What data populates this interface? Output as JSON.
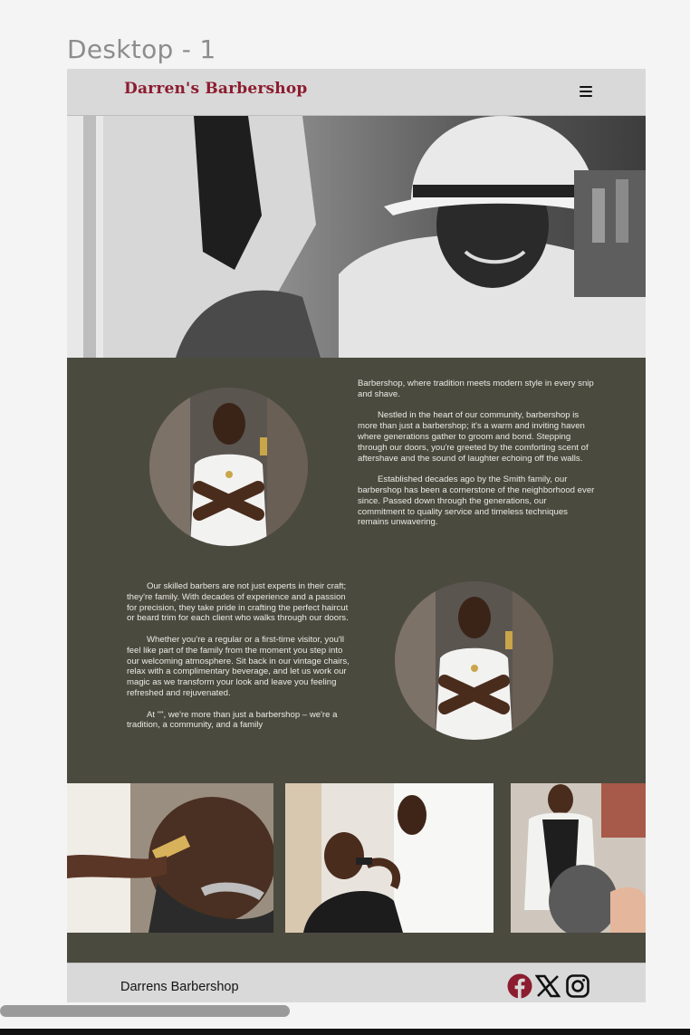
{
  "canvas": {
    "frame_title": "Desktop - 1"
  },
  "navbar": {
    "brand": "Darren's Barbershop",
    "menu_icon": "hamburger-menu-icon"
  },
  "about": {
    "paragraph_1": "Barbershop, where tradition meets modern style in every snip and shave.",
    "paragraph_2": "Nestled in the heart of our community, barbershop is more than just a barbershop; it's a warm and inviting haven where generations gather to groom and bond. Stepping through our doors, you're greeted by the comforting scent of aftershave and the sound of laughter echoing off the walls.",
    "paragraph_3": "Established decades ago by the Smith family, our barbershop has been a cornerstone of the neighborhood ever since. Passed down through the generations, our commitment to quality service and timeless techniques remains unwavering.",
    "paragraph_4": "Our skilled barbers are not just experts in their craft; they're family. With decades of experience and a passion for precision, they take pride in crafting the perfect haircut or beard trim for each client who walks through our doors.",
    "paragraph_5": "Whether you're a regular or a first-time visitor, you'll feel like part of the family from the moment you step into our welcoming atmosphere. Sit back in our vintage chairs, relax with a complimentary beverage, and let us work our magic as we transform your look and leave you feeling refreshed and rejuvenated.",
    "paragraph_6": "At \"\", we're more than just a barbershop – we're a tradition, a community, and a family"
  },
  "footer": {
    "name": "Darrens Barbershop",
    "social_icons": [
      "facebook-icon",
      "x-twitter-icon",
      "instagram-icon"
    ]
  },
  "colors": {
    "brand": "#8c1c2f",
    "section_bg": "#4b4a3f",
    "bar_bg": "#d9d9d9",
    "facebook": "#8c1c2f"
  }
}
